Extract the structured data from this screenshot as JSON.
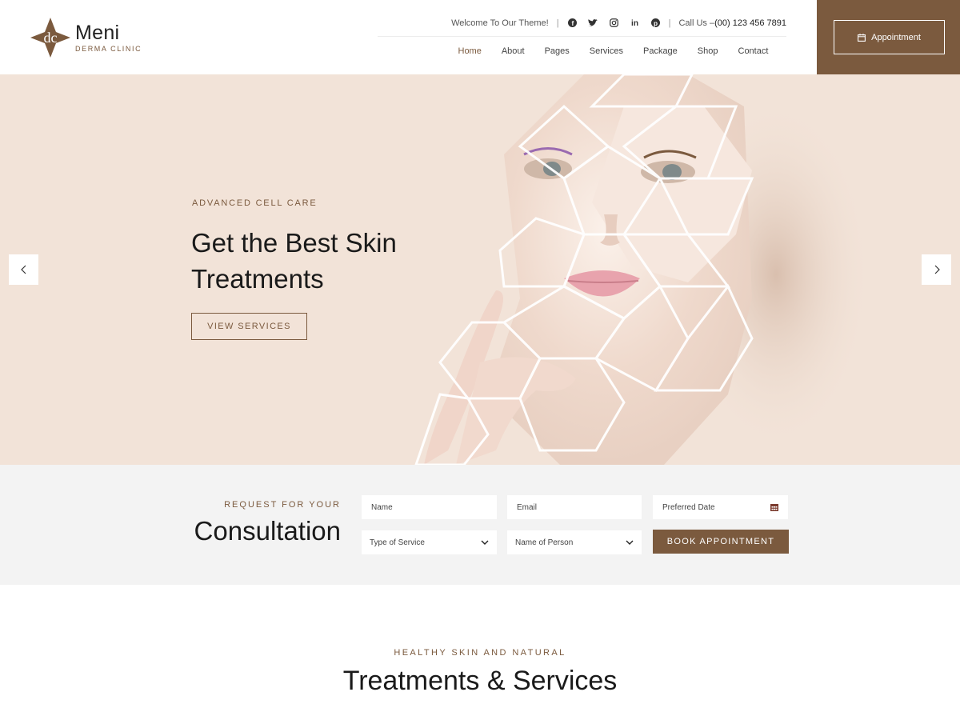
{
  "brand": {
    "name": "Meni",
    "tagline": "DERMA CLINIC",
    "accent": "#7b5a3e",
    "hero_bg": "#f2e3d8"
  },
  "topbar": {
    "welcome": "Welcome To Our Theme!",
    "socials": [
      "facebook-icon",
      "twitter-icon",
      "instagram-icon",
      "linkedin-icon",
      "pinterest-icon"
    ],
    "call_label": "Call Us – ",
    "phone": "(00) 123 456 7891"
  },
  "nav": {
    "items": [
      "Home",
      "About",
      "Pages",
      "Services",
      "Package",
      "Shop",
      "Contact"
    ],
    "active": "Home"
  },
  "appointment": {
    "label": "Appointment",
    "icon": "calendar-icon"
  },
  "hero": {
    "eyebrow": "ADVANCED CELL CARE",
    "title": "Get the Best Skin Treatments",
    "button": "VIEW SERVICES"
  },
  "consultation": {
    "eyebrow": "REQUEST FOR YOUR",
    "title": "Consultation",
    "name_placeholder": "Name",
    "email_placeholder": "Email",
    "date_placeholder": "Preferred Date",
    "service_select": "Type of Service",
    "person_select": "Name of Person",
    "submit": "BOOK APPOINTMENT"
  },
  "services": {
    "eyebrow": "HEALTHY SKIN AND NATURAL",
    "title": "Treatments & Services"
  }
}
